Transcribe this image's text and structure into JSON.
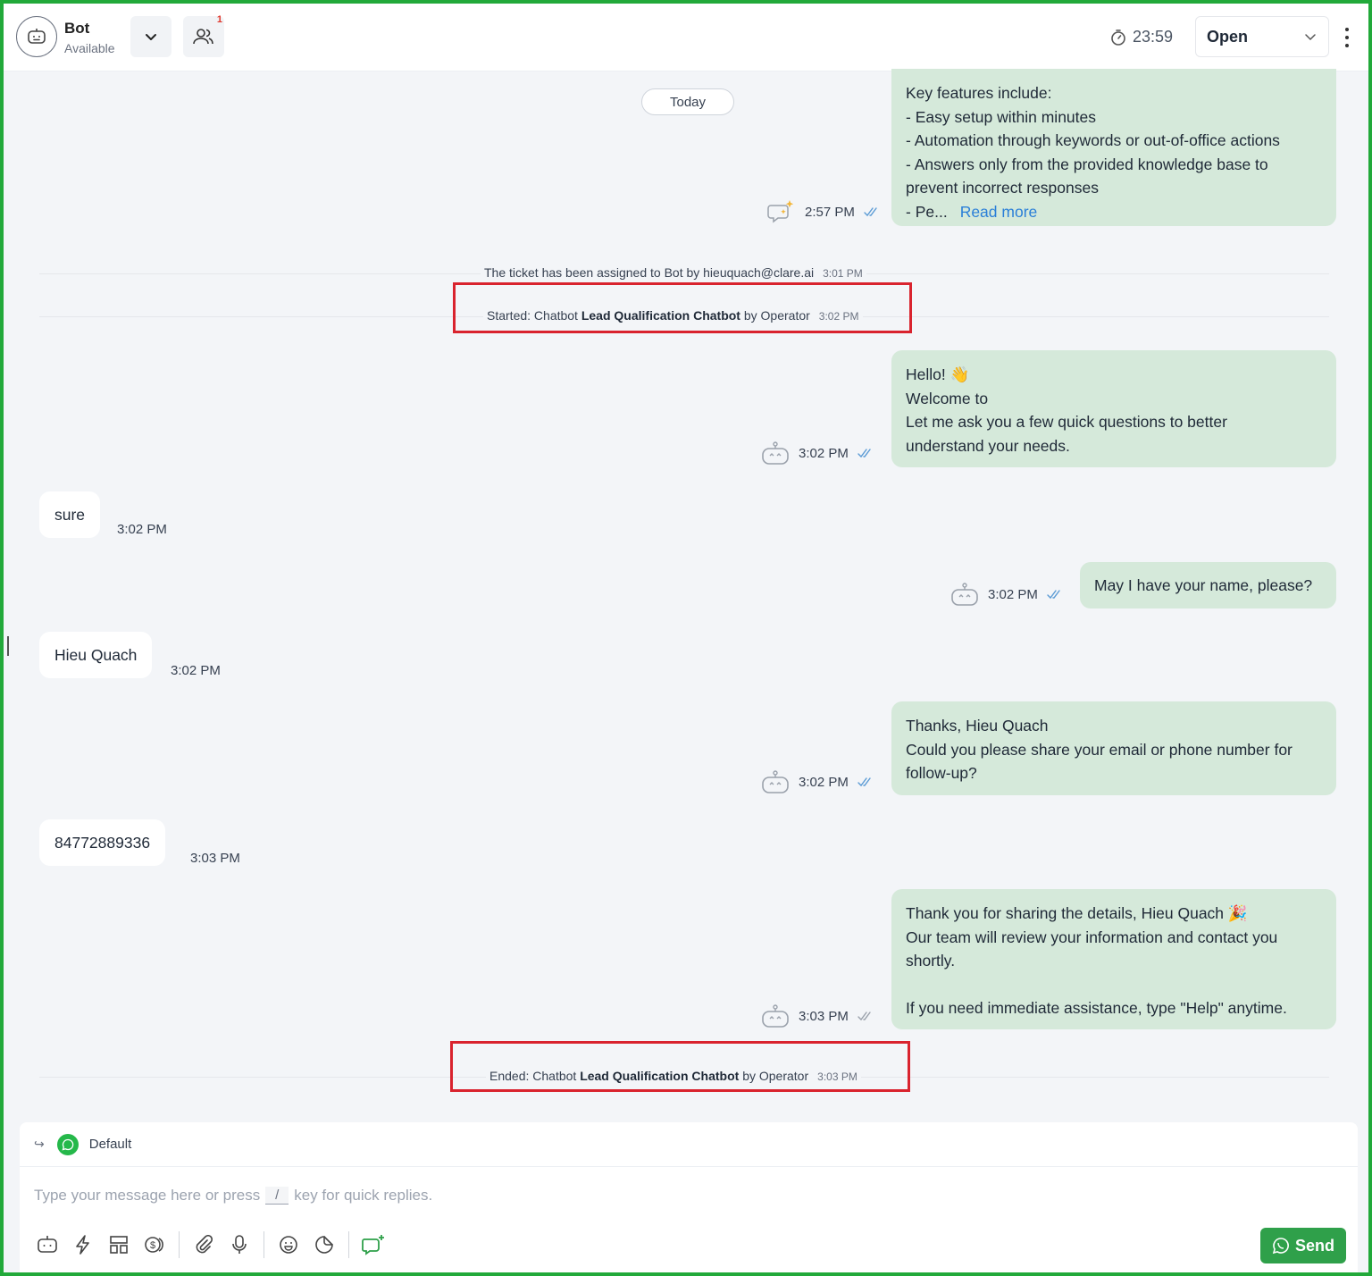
{
  "header": {
    "agent_name": "Bot",
    "agent_status": "Available",
    "participants_badge": "1",
    "timer": "23:59",
    "status": "Open"
  },
  "chat": {
    "date_divider": "Today",
    "messages": [
      {
        "direction": "outgoing",
        "lines": [
          "Key features include:",
          "- Easy setup within minutes",
          "- Automation through keywords or out-of-office actions",
          "- Answers only from the provided knowledge base to",
          "prevent incorrect responses"
        ],
        "truncated_line": "- Pe...",
        "read_more": "Read more",
        "time": "2:57 PM",
        "sender_icon": "ai-sparkle-chat-icon"
      },
      {
        "direction": "outgoing",
        "lines": [
          "Hello! 👋",
          "Welcome to",
          "Let me ask you a few quick questions to better",
          "understand your needs."
        ],
        "time": "3:02 PM",
        "sender_icon": "bot-icon"
      },
      {
        "direction": "incoming",
        "text": "sure",
        "time": "3:02 PM"
      },
      {
        "direction": "outgoing",
        "lines": [
          "May I have your name, please?"
        ],
        "time": "3:02 PM",
        "sender_icon": "bot-icon"
      },
      {
        "direction": "incoming",
        "text": "Hieu Quach",
        "time": "3:02 PM"
      },
      {
        "direction": "outgoing",
        "lines": [
          "Thanks, Hieu Quach",
          "Could you please share your email or phone number for",
          "follow-up?"
        ],
        "time": "3:02 PM",
        "sender_icon": "bot-icon"
      },
      {
        "direction": "incoming",
        "text": "84772889336",
        "time": "3:03 PM"
      },
      {
        "direction": "outgoing",
        "lines": [
          "Thank you for sharing the details, Hieu Quach 🎉",
          "Our team will review your information and contact you",
          "shortly.",
          "",
          "If you need immediate assistance, type \"Help\" anytime."
        ],
        "time": "3:03 PM",
        "sender_icon": "bot-icon"
      }
    ],
    "system_events": [
      {
        "text": "The ticket has been assigned to Bot by hieuquach@clare.ai",
        "time": "3:01 PM"
      },
      {
        "prefix": "Started: Chatbot ",
        "bold": "Lead Qualification Chatbot",
        "suffix": " by Operator",
        "time": "3:02 PM",
        "highlighted": true
      },
      {
        "prefix": "Ended: Chatbot ",
        "bold": "Lead Qualification Chatbot",
        "suffix": " by Operator",
        "time": "3:03 PM",
        "highlighted": true
      }
    ]
  },
  "composer": {
    "channel_name": "Default",
    "placeholder_before": "Type your message here or press",
    "placeholder_key": "/",
    "placeholder_after": "key for quick replies.",
    "toolbar_icons": [
      "bot-icon",
      "lightning-icon",
      "template-icon",
      "payment-icon",
      "attachment-icon",
      "microphone-icon",
      "emoji-icon",
      "sticker-icon",
      "ai-compose-icon"
    ],
    "send_label": "Send"
  },
  "colors": {
    "outgoing_bubble": "#d5e9da",
    "incoming_bubble": "#ffffff",
    "background": "#f3f5f8",
    "send_button": "#2fa04a",
    "highlight_box": "#d9232e",
    "read_more": "#2a7fd8",
    "frame_border": "#22a93a"
  }
}
